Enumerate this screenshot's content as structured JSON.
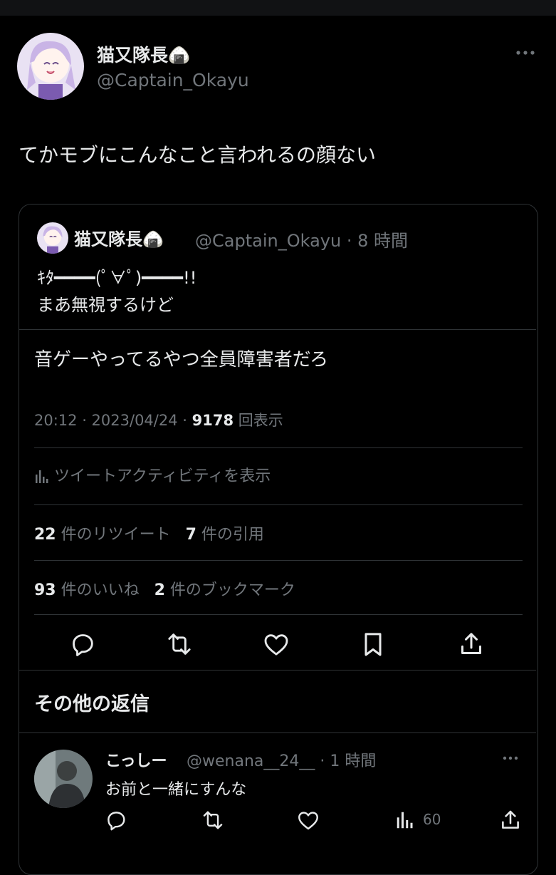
{
  "profile": {
    "display_name": "猫又隊長🍙",
    "handle": "@Captain_Okayu"
  },
  "tweet": {
    "text": "てかモブにこんなこと言われるの顔ない"
  },
  "quote": {
    "display_name": "猫又隊長🍙",
    "handle_time": "@Captain_Okayu · 8 時間",
    "line1": "ｷﾀ━━━━(ﾟ∀ﾟ)━━━━!!",
    "line2": "まあ無視するけど",
    "main_text": "音ゲーやってるやつ全員障害者だろ",
    "time": "20:12 · 2023/04/24 · ",
    "views_count": "9178",
    "views_label": " 回表示",
    "activity_label": "ツイートアクティビティを表示",
    "retweets_count": "22",
    "retweets_label": " 件のリツイート",
    "quotes_count": "7",
    "quotes_label": " 件の引用",
    "likes_count": "93",
    "likes_label": " 件のいいね",
    "bookmarks_count": "2",
    "bookmarks_label": " 件のブックマーク"
  },
  "replies_section": {
    "title": "その他の返信"
  },
  "reply": {
    "display_name": "こっしー",
    "handle_time": "@wenana__24__ · 1 時間",
    "text": "お前と一緒にすんな",
    "views": "60"
  },
  "icons": [
    "more-icon",
    "reply-icon",
    "retweet-icon",
    "like-icon",
    "bookmark-icon",
    "share-icon",
    "analytics-icon"
  ],
  "colors": {
    "background": "#000000",
    "primary_text": "#e7e9ea",
    "secondary_text": "#71767b",
    "border": "#2f3336"
  }
}
